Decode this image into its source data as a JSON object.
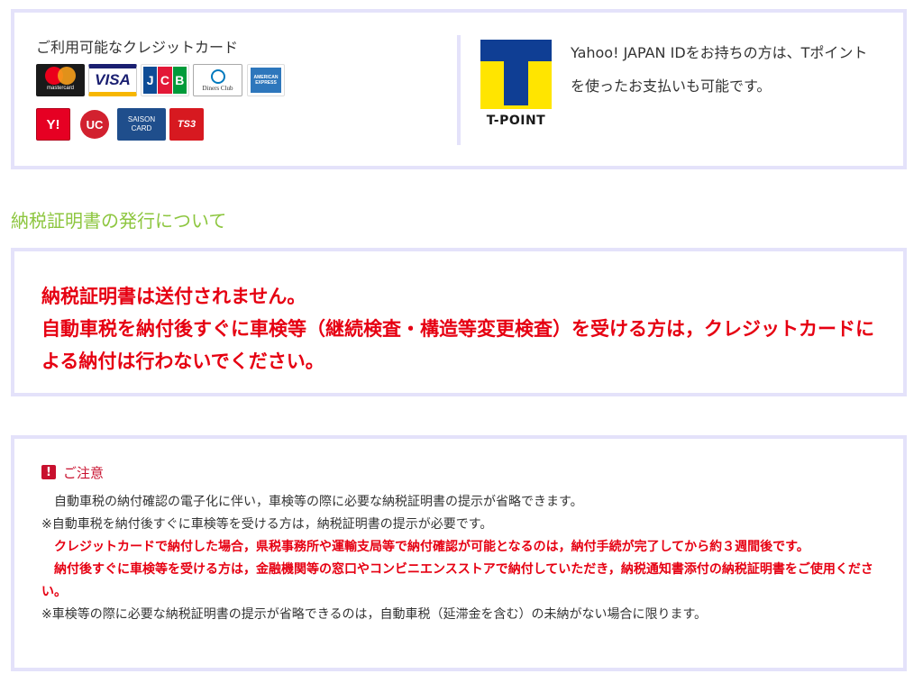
{
  "payment": {
    "cards_title": "ご利用可能なクレジットカード",
    "cards": [
      {
        "name": "mastercard",
        "text": "mastercard"
      },
      {
        "name": "visa",
        "text": "VISA"
      },
      {
        "name": "jcb",
        "text": "JCB"
      },
      {
        "name": "diners",
        "text": "Diners Club"
      },
      {
        "name": "amex",
        "text": "AMERICAN EXPRESS"
      },
      {
        "name": "yahoo",
        "text": "Y!"
      },
      {
        "name": "uc",
        "text": "UC"
      },
      {
        "name": "saison",
        "text": "SAISON CARD"
      },
      {
        "name": "ts3",
        "text": "TS3"
      }
    ],
    "tpoint_logo_text": "T-POINT",
    "tpoint_text": "Yahoo! JAPAN IDをお持ちの方は、Tポイントを使ったお支払いも可能です。"
  },
  "section_heading": "納税証明書の発行について",
  "notice": {
    "line1": "納税証明書は送付されません。",
    "line2": "自動車税を納付後すぐに車検等（継続検査・構造等変更検査）を受ける方は，クレジットカードによる納付は行わないでください。"
  },
  "caution": {
    "icon": "!",
    "title": "ご注意",
    "p1": "　自動車税の納付確認の電子化に伴い，車検等の際に必要な納税証明書の提示が省略できます。",
    "p2": "※自動車税を納付後すぐに車検等を受ける方は，納税証明書の提示が必要です。",
    "p3": "　クレジットカードで納付した場合，県税事務所や運輸支局等で納付確認が可能となるのは，納付手続が完了してから約３週間後です。",
    "p4": "　納付後すぐに車検等を受ける方は，金融機関等の窓口やコンビニエンスストアで納付していただき，納税通知書添付の納税証明書をご使用ください。",
    "p5": "※車検等の際に必要な納税証明書の提示が省略できるのは，自動車税（延滞金を含む）の未納がない場合に限ります。"
  },
  "colors": {
    "border": "#e4e2fa",
    "heading_green": "#8dc63f",
    "alert_red": "#e60012",
    "caution_red": "#c8102e",
    "tpoint_yellow": "#ffe500",
    "tpoint_blue": "#0f3e94"
  }
}
